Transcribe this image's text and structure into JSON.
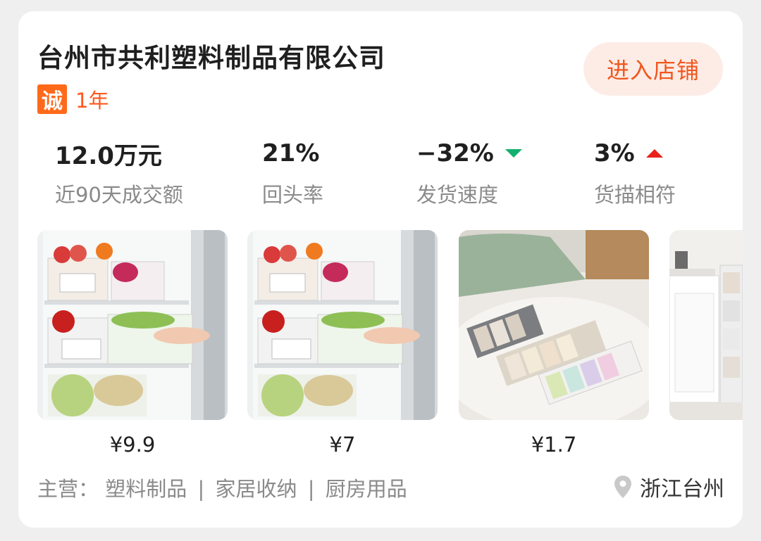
{
  "shop": {
    "name": "台州市共利塑料制品有限公司",
    "badge_icon": "诚",
    "years": "1年",
    "enter_button": "进入店铺"
  },
  "stats": [
    {
      "value": "12.0万元",
      "label": "近90天成交额"
    },
    {
      "value": "21%",
      "label": "回头率"
    },
    {
      "value": "−32%",
      "label": "发货速度",
      "trend": "down",
      "trend_color": "#12b06e"
    },
    {
      "value": "3%",
      "label": "货描相符",
      "trend": "up",
      "trend_color": "#e8201a"
    }
  ],
  "products": [
    {
      "image": "fridge-storage-box-photo",
      "price": "¥9.9"
    },
    {
      "image": "fridge-storage-box-photo",
      "price": "¥7"
    },
    {
      "image": "underwear-organizer-photo",
      "price": "¥1.7"
    },
    {
      "image": "kitchen-cabinet-photo"
    }
  ],
  "bottom": {
    "main_label": "主营：",
    "categories": [
      "塑料制品",
      "家居收纳",
      "厨房用品"
    ],
    "separator": "|",
    "location": "浙江台州",
    "location_icon": "map-pin-icon"
  },
  "colors": {
    "accent": "#ff5a1f",
    "button_bg": "#fdece6",
    "down": "#12b06e",
    "up": "#e8201a"
  }
}
